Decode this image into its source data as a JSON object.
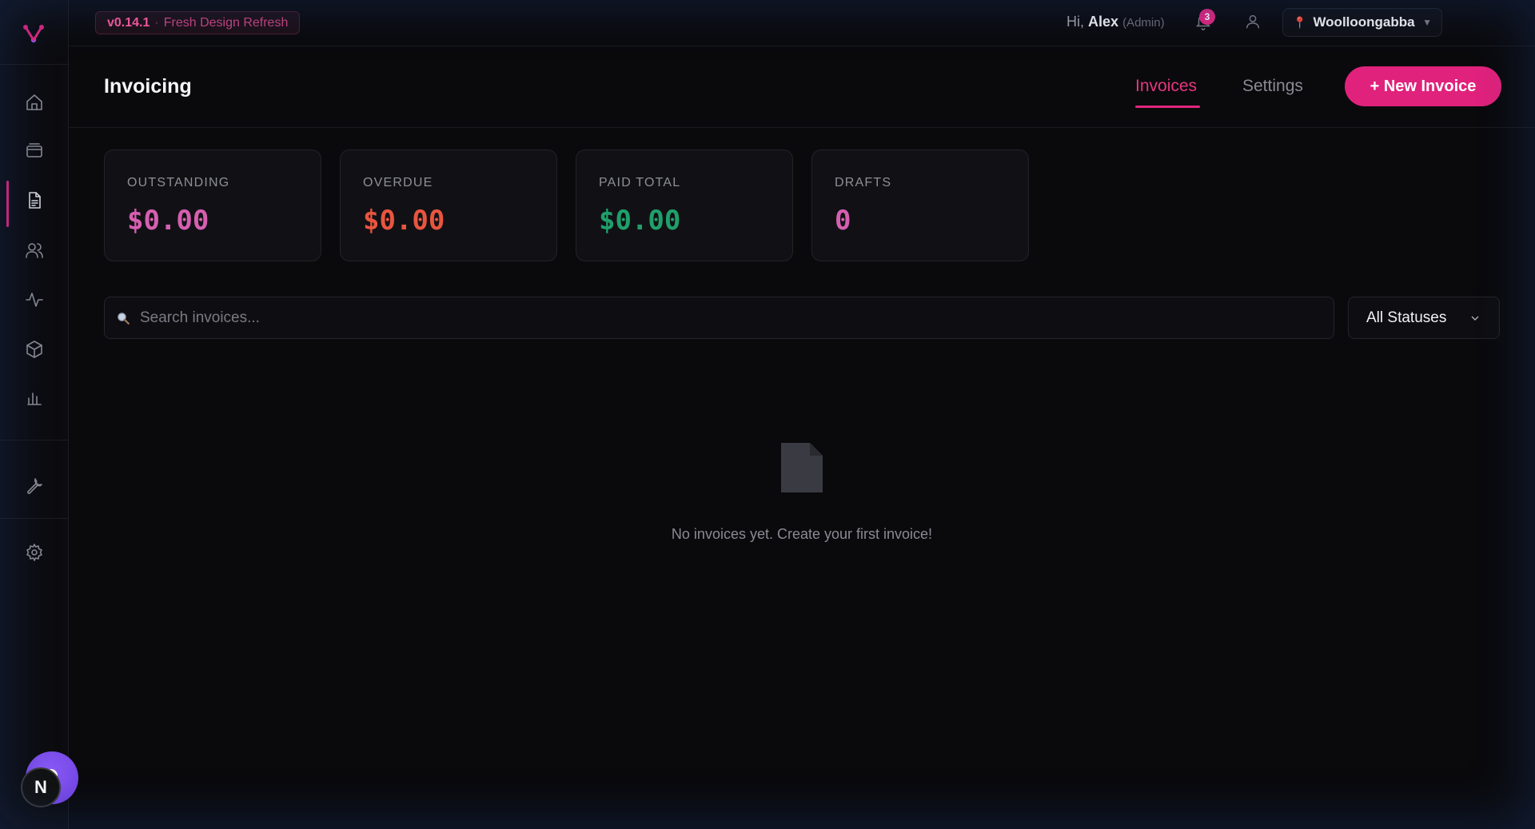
{
  "topbar": {
    "version": "v0.14.1",
    "version_sep": "·",
    "version_note": "Fresh Design Refresh",
    "greeting_prefix": "Hi,",
    "user_name": "Alex",
    "user_role": "(Admin)",
    "notification_count": "3",
    "location": "Woolloongabba"
  },
  "sidebar": {
    "items": [
      {
        "icon": "home-icon"
      },
      {
        "icon": "wallet-icon"
      },
      {
        "icon": "document-icon"
      },
      {
        "icon": "users-icon"
      },
      {
        "icon": "activity-icon"
      },
      {
        "icon": "box-icon"
      },
      {
        "icon": "bar-chart-icon"
      },
      {
        "icon": "wrench-icon"
      },
      {
        "icon": "gear-icon"
      }
    ],
    "active_index": 2,
    "avatar_letter": "N"
  },
  "header": {
    "title": "Invoicing",
    "tabs": [
      {
        "label": "Invoices",
        "active": true
      },
      {
        "label": "Settings",
        "active": false
      }
    ],
    "new_button": "+ New Invoice"
  },
  "stats": [
    {
      "label": "OUTSTANDING",
      "value": "$0.00",
      "color": "#d55fb0"
    },
    {
      "label": "OVERDUE",
      "value": "$0.00",
      "color": "#e8553f"
    },
    {
      "label": "PAID TOTAL",
      "value": "$0.00",
      "color": "#1fa06a"
    },
    {
      "label": "DRAFTS",
      "value": "0",
      "color": "#d55fb0"
    }
  ],
  "search": {
    "placeholder": "Search invoices...",
    "value": ""
  },
  "filter": {
    "selected": "All Statuses"
  },
  "empty_state": {
    "icon": "document-icon",
    "message": "No invoices yet. Create your first invoice!"
  },
  "colors": {
    "accent": "#e0267f",
    "background": "#0a0a0d",
    "card": "#111115"
  }
}
